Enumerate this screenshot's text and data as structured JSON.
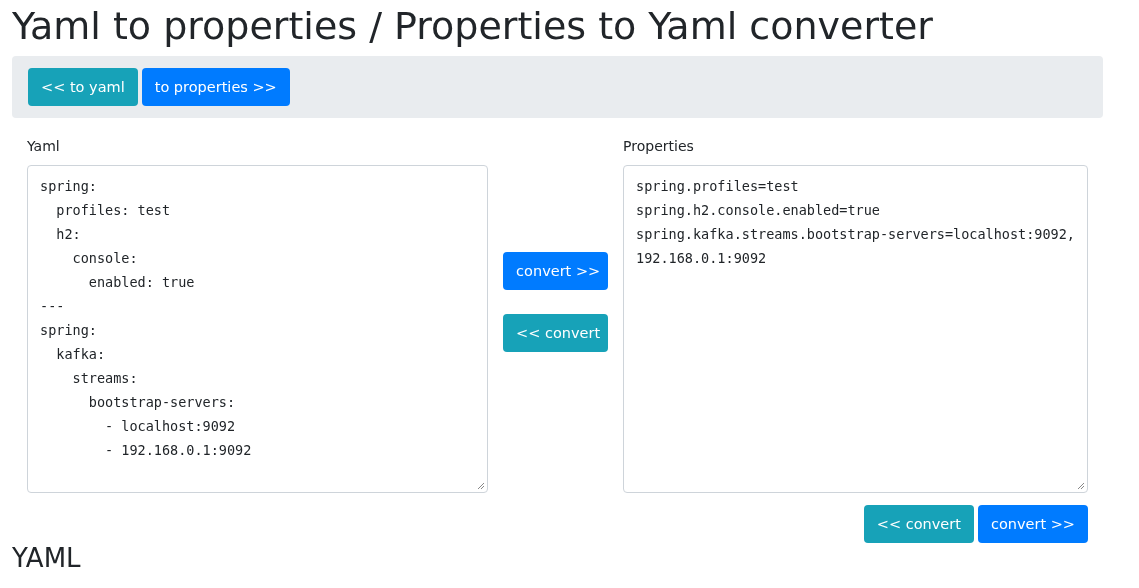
{
  "title": "Yaml to properties / Properties to Yaml converter",
  "toolbar": [
    {
      "label": "<< to yaml",
      "kind": "info"
    },
    {
      "label": "to properties >>",
      "kind": "primary"
    }
  ],
  "yaml": {
    "label": "Yaml",
    "lines": [
      "spring:",
      "  profiles: test",
      "  h2:",
      "    console:",
      "      enabled: true",
      "---",
      "spring:",
      "  kafka:",
      "    streams:",
      "      bootstrap-servers:",
      "        - localhost:9092",
      "        - 192.168.0.1:9092"
    ]
  },
  "middle_buttons": [
    {
      "label": "convert >>",
      "kind": "primary"
    },
    {
      "label": "<< convert",
      "kind": "info"
    }
  ],
  "properties": {
    "label": "Properties",
    "lines": [
      "spring.profiles=test",
      "spring.h2.console.enabled=true",
      "spring.kafka.streams.bootstrap-servers=localhost:9092,",
      "192.168.0.1:9092"
    ]
  },
  "bottom_buttons": [
    {
      "label": "<< convert",
      "kind": "info"
    },
    {
      "label": "convert >>",
      "kind": "primary"
    }
  ],
  "next_heading": "YAML"
}
